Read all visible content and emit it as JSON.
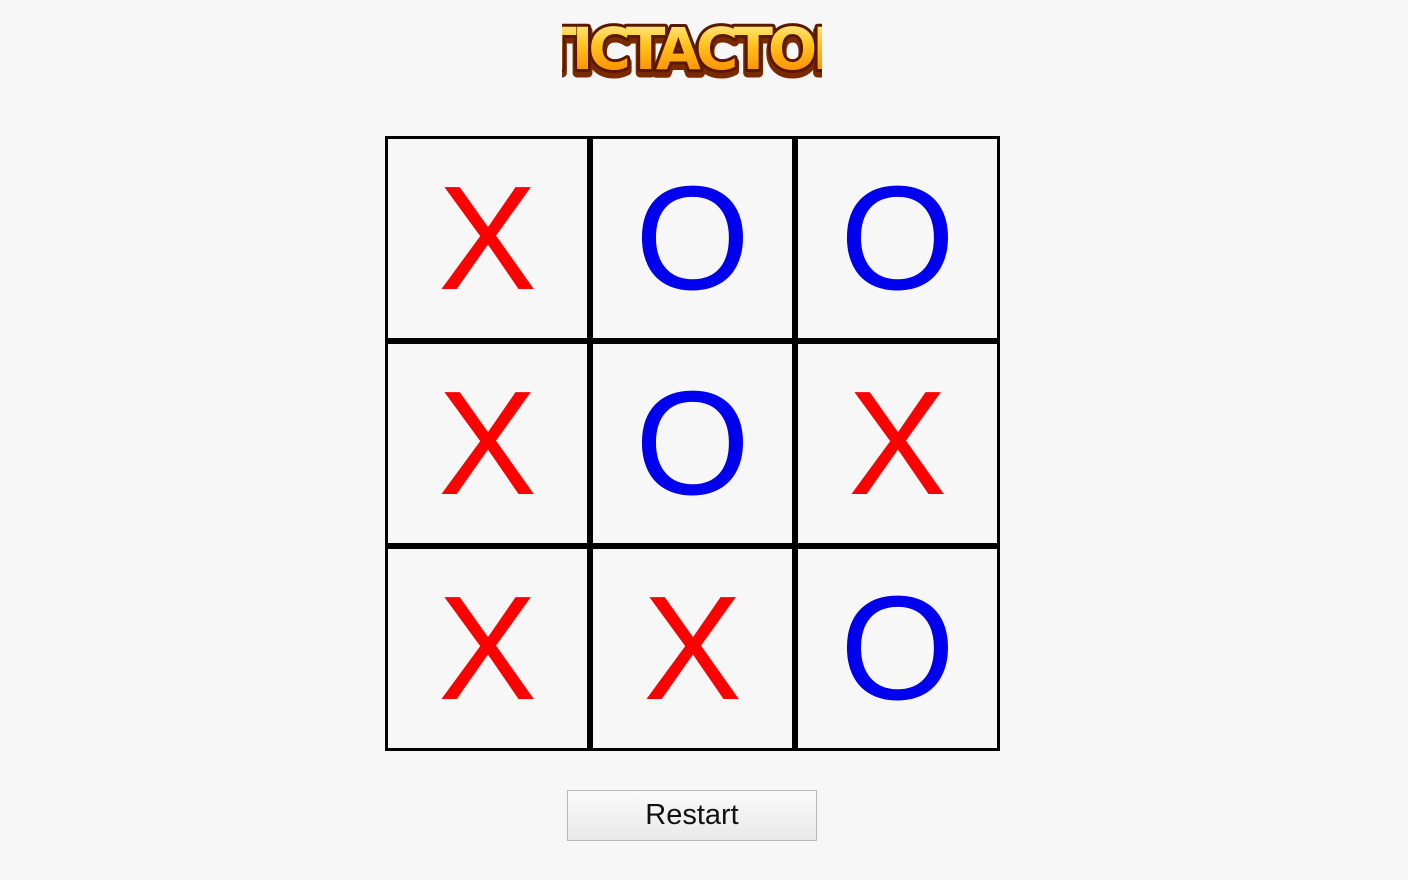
{
  "header": {
    "logo_text": "TICTACTOE"
  },
  "board": {
    "cells": [
      {
        "mark": "X"
      },
      {
        "mark": "O"
      },
      {
        "mark": "O"
      },
      {
        "mark": "X"
      },
      {
        "mark": "O"
      },
      {
        "mark": "X"
      },
      {
        "mark": "X"
      },
      {
        "mark": "X"
      },
      {
        "mark": "O"
      }
    ]
  },
  "controls": {
    "restart_label": "Restart"
  },
  "colors": {
    "x_mark": "#ff0000",
    "o_mark": "#0000ee",
    "grid": "#000000",
    "background": "#f7f7f7"
  }
}
